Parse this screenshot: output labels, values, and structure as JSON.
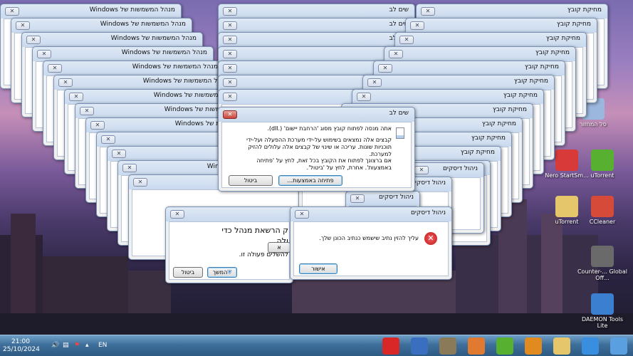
{
  "desktop_icons": [
    {
      "label": "סל המחזור",
      "icon": "recycle-bin-icon",
      "color": "#9bb7dd"
    },
    {
      "label": "Nero StartSm...",
      "icon": "nero-icon",
      "color": "#d83a3a"
    },
    {
      "label": "uTorrent",
      "icon": "utorrent-icon",
      "color": "#58b031"
    },
    {
      "label": "uTorrent",
      "icon": "utorrent-folder-icon",
      "color": "#e5c66a"
    },
    {
      "label": "CCleaner",
      "icon": "ccleaner-icon",
      "color": "#d64a3a"
    },
    {
      "label": "Counter-... Global Off...",
      "icon": "counter-strike-icon",
      "color": "#6a6a6a"
    },
    {
      "label": "DAEMON Tools Lite",
      "icon": "daemon-tools-icon",
      "color": "#3a7fd0"
    }
  ],
  "stacks": {
    "admin_title": "מנהל המשמשות של Windows",
    "admin_partial": "Windo",
    "warning_title": "שים לב",
    "delete_title": "מחיקת קובץ",
    "disk_title": "ניהול דיסקים"
  },
  "warning_dialog": {
    "title": "שים לב",
    "line1": "אתה מנסה לפתוח קובץ מסוג 'הרחבת יישום' (.dll).",
    "line2": "קבצים אלה נמצאים בשימוש על-ידי מערכת ההפעלה ועל-ידי תוכניות שונות. עריכה או שינוי של קבצים אלה עלולים להזיק למערכת.",
    "line3": "אם ברצונך לפתוח את הקובץ בכל זאת, לחץ על 'פתיחה באמצעות'. אחרת, לחץ על 'ביטול'.",
    "open_with": "פתיחה באמצעות...",
    "cancel": "ביטול"
  },
  "uac_dialog": {
    "text1": "ק הרשאת מנהל כדי",
    "text2": "ולה.",
    "text3": "להשלים פעולה זו.",
    "continue": "המשך",
    "cancel": "ביטול",
    "side_btn": "א"
  },
  "disk_dialog": {
    "title": "ניהול דיסקים",
    "message": "עליך להזין נתיב שישמש כנתיב הכונן שלך.",
    "ok": "אישור"
  },
  "taskbar": {
    "time": "21:00",
    "date": "25/10/2024",
    "lang": "EN",
    "items": [
      {
        "icon": "opera-icon",
        "color": "#d92626"
      },
      {
        "icon": "daemon-tools-taskbar-icon",
        "color": "#3a6fc0"
      },
      {
        "icon": "counter-strike-taskbar-icon",
        "color": "#8a7a5a"
      },
      {
        "icon": "ccleaner-taskbar-icon",
        "color": "#e07a30"
      },
      {
        "icon": "utorrent-taskbar-icon",
        "color": "#58b031"
      },
      {
        "icon": "media-player-icon",
        "color": "#e08a20"
      },
      {
        "icon": "explorer-folder-icon",
        "color": "#e5c66a"
      },
      {
        "icon": "internet-explorer-icon",
        "color": "#3a8ee0"
      },
      {
        "icon": "windows-start-icon",
        "color": "#5aa0e0"
      }
    ]
  }
}
